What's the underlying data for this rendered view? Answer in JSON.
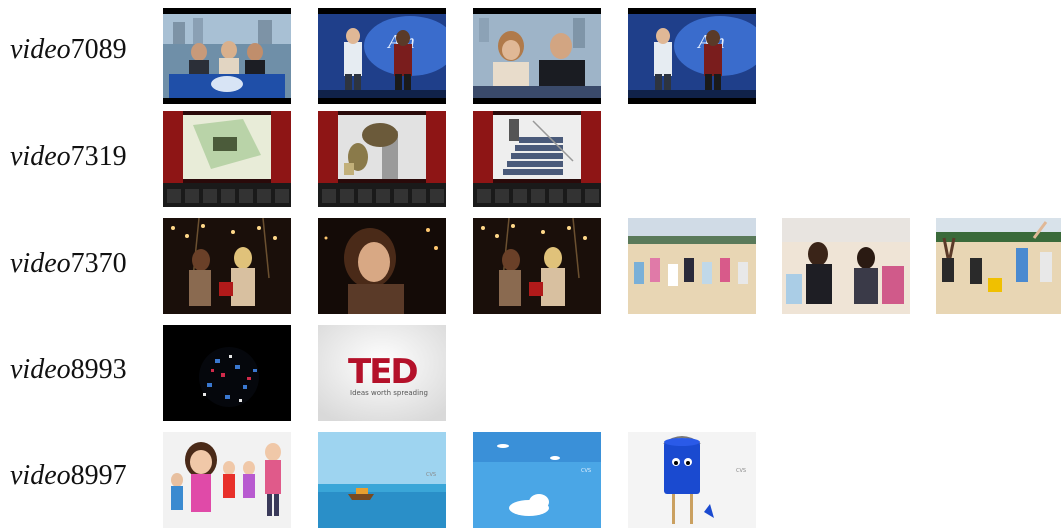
{
  "rows": [
    {
      "prefix": "video",
      "id": "7089"
    },
    {
      "prefix": "video",
      "id": "7319"
    },
    {
      "prefix": "video",
      "id": "7370"
    },
    {
      "prefix": "video",
      "id": "8993"
    },
    {
      "prefix": "video",
      "id": "8997"
    }
  ],
  "frames": {
    "ted_logo": "TED",
    "ted_tagline": "Ideas worth spreading"
  },
  "colors": {
    "idol_blue": "#1f4fa8",
    "theater_red": "#8e1515",
    "sand": "#e8d6b4",
    "sky": "#4aa6e6",
    "ted_red": "#b4112a"
  }
}
